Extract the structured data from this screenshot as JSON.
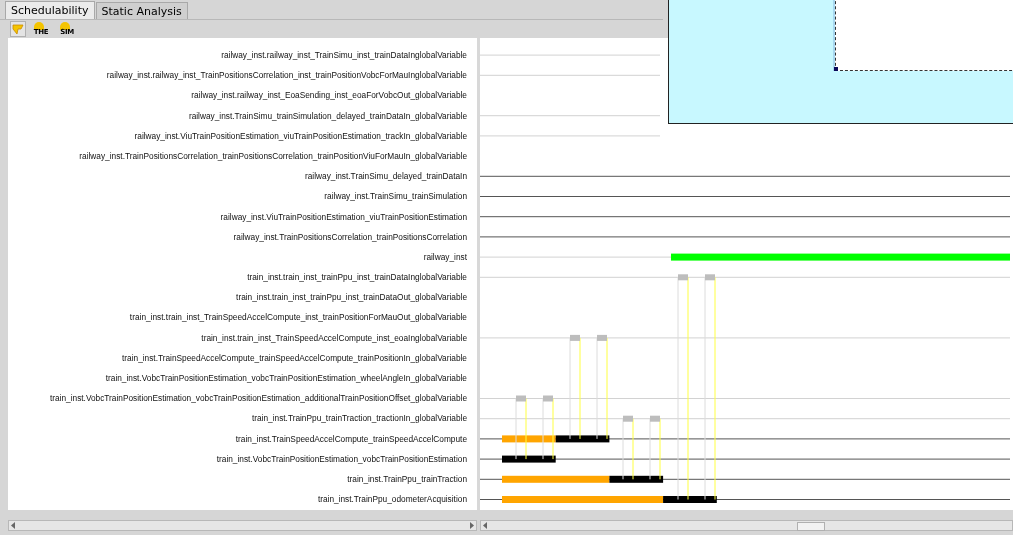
{
  "tabs": [
    {
      "label": "Schedulability",
      "selected": true
    },
    {
      "label": "Static Analysis",
      "selected": false
    }
  ],
  "toolbar": [
    {
      "kind": "pointer",
      "selected": true
    },
    {
      "kind": "badge",
      "label": "THE",
      "selected": false
    },
    {
      "kind": "badge",
      "label": "SIM",
      "selected": false
    }
  ],
  "rows": [
    {
      "label": "railway_inst.railway_inst_TrainSimu_inst_trainDataInglobalVariable",
      "kind": "variable",
      "traced": true
    },
    {
      "label": "railway_inst.railway_inst_TrainPositionsCorrelation_inst_trainPositionVobcForMauInglobalVariable",
      "kind": "variable",
      "traced": true
    },
    {
      "label": "railway_inst.railway_inst_EoaSending_inst_eoaForVobcOut_globalVariable",
      "kind": "variable",
      "traced": false
    },
    {
      "label": "railway_inst.TrainSimu_trainSimulation_delayed_trainDataIn_globalVariable",
      "kind": "variable",
      "traced": true
    },
    {
      "label": "railway_inst.ViuTrainPositionEstimation_viuTrainPositionEstimation_trackIn_globalVariable",
      "kind": "variable",
      "traced": true
    },
    {
      "label": "railway_inst.TrainPositionsCorrelation_trainPositionsCorrelation_trainPositionViuForMauIn_globalVariable",
      "kind": "variable",
      "traced": false
    },
    {
      "label": "railway_inst.TrainSimu_delayed_trainDataIn",
      "kind": "task",
      "segments": []
    },
    {
      "label": "railway_inst.TrainSimu_trainSimulation",
      "kind": "task",
      "segments": []
    },
    {
      "label": "railway_inst.ViuTrainPositionEstimation_viuTrainPositionEstimation",
      "kind": "task",
      "segments": []
    },
    {
      "label": "railway_inst.TrainPositionsCorrelation_trainPositionsCorrelation",
      "kind": "task",
      "segments": []
    },
    {
      "label": "railway_inst",
      "kind": "instance",
      "active": true
    },
    {
      "label": "train_inst.train_inst_trainPpu_inst_trainDataInglobalVariable",
      "kind": "variable",
      "traced": true
    },
    {
      "label": "train_inst.train_inst_trainPpu_inst_trainDataOut_globalVariable",
      "kind": "variable",
      "traced": false
    },
    {
      "label": "train_inst.train_inst_TrainSpeedAccelCompute_inst_trainPositionForMauOut_globalVariable",
      "kind": "variable",
      "traced": false
    },
    {
      "label": "train_inst.train_inst_TrainSpeedAccelCompute_inst_eoaInglobalVariable",
      "kind": "variable",
      "traced": true
    },
    {
      "label": "train_inst.TrainSpeedAccelCompute_trainSpeedAccelCompute_trainPositionIn_globalVariable",
      "kind": "variable",
      "traced": false
    },
    {
      "label": "train_inst.VobcTrainPositionEstimation_vobcTrainPositionEstimation_wheelAngleIn_globalVariable",
      "kind": "variable",
      "traced": false
    },
    {
      "label": "train_inst.VobcTrainPositionEstimation_vobcTrainPositionEstimation_additionalTrainPositionOffset_globalVariable",
      "kind": "variable",
      "traced": true
    },
    {
      "label": "train_inst.TrainPpu_trainTraction_tractionIn_globalVariable",
      "kind": "variable",
      "traced": true
    },
    {
      "label": "train_inst.TrainSpeedAccelCompute_trainSpeedAccelCompute",
      "kind": "task",
      "segments": [
        {
          "kind": "ready"
        },
        {
          "kind": "running"
        }
      ]
    },
    {
      "label": "train_inst.VobcTrainPositionEstimation_vobcTrainPositionEstimation",
      "kind": "task",
      "segments": [
        {
          "kind": "running"
        }
      ]
    },
    {
      "label": "train_inst.TrainPpu_trainTraction",
      "kind": "task",
      "segments": [
        {
          "kind": "ready"
        },
        {
          "kind": "running"
        }
      ]
    },
    {
      "label": "train_inst.TrainPpu_odometerAcquisition",
      "kind": "task",
      "segments": [
        {
          "kind": "ready"
        },
        {
          "kind": "running"
        }
      ]
    }
  ]
}
